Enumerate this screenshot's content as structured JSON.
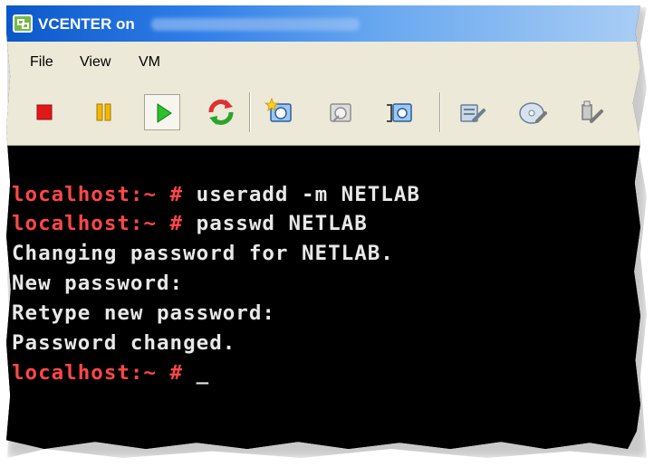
{
  "window": {
    "title": "VCENTER on",
    "app_icon": "vsphere-console-icon"
  },
  "menu": {
    "items": [
      "File",
      "View",
      "VM"
    ]
  },
  "toolbar": {
    "buttons": [
      {
        "name": "power-off",
        "icon": "stop-square-icon",
        "color": "#e11818"
      },
      {
        "name": "suspend",
        "icon": "pause-icon",
        "color": "#e0a800"
      },
      {
        "name": "power-on",
        "icon": "play-icon",
        "color": "#25b825"
      },
      {
        "name": "reset",
        "icon": "reset-icon",
        "color": "#e03030"
      },
      {
        "name": "take-snapshot",
        "icon": "snapshot-icon"
      },
      {
        "name": "revert-snapshot",
        "icon": "revert-snapshot-icon"
      },
      {
        "name": "snapshot-manager",
        "icon": "snapshot-manager-icon"
      },
      {
        "name": "edit-settings",
        "icon": "edit-settings-icon"
      },
      {
        "name": "cd-dvd",
        "icon": "disc-icon"
      },
      {
        "name": "usb-devices",
        "icon": "usb-icon"
      }
    ]
  },
  "console": {
    "lines": [
      {
        "prompt": "localhost:~ #",
        "text": " useradd -m NETLAB"
      },
      {
        "prompt": "localhost:~ #",
        "text": " passwd NETLAB"
      },
      {
        "prompt": "",
        "text": "Changing password for NETLAB."
      },
      {
        "prompt": "",
        "text": "New password:"
      },
      {
        "prompt": "",
        "text": "Retype new password:"
      },
      {
        "prompt": "",
        "text": "Password changed."
      },
      {
        "prompt": "localhost:~ #",
        "text": " _"
      }
    ],
    "colors": {
      "prompt": "#ff4747",
      "text": "#e8e8e8",
      "background": "#000000"
    }
  }
}
